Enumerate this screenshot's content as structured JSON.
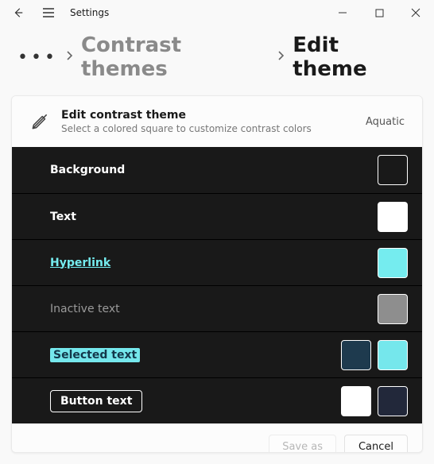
{
  "window": {
    "title": "Settings"
  },
  "breadcrumb": {
    "parent": "Contrast themes",
    "current": "Edit theme"
  },
  "header": {
    "title": "Edit contrast theme",
    "subtitle": "Select a colored square to customize contrast colors",
    "theme_name": "Aquatic"
  },
  "rows": {
    "background": {
      "label": "Background",
      "color": "#191919"
    },
    "text": {
      "label": "Text",
      "color": "#ffffff"
    },
    "hyperlink": {
      "label": "Hyperlink",
      "color": "#75ecef"
    },
    "inactive": {
      "label": "Inactive text",
      "color": "#8e8e8e"
    },
    "selected": {
      "label": "Selected text",
      "fg": "#1e3a4e",
      "bg": "#75e7ec"
    },
    "button": {
      "label": "Button text",
      "fg": "#ffffff",
      "bg": "#22283a"
    }
  },
  "footer": {
    "save": "Save as",
    "cancel": "Cancel"
  }
}
